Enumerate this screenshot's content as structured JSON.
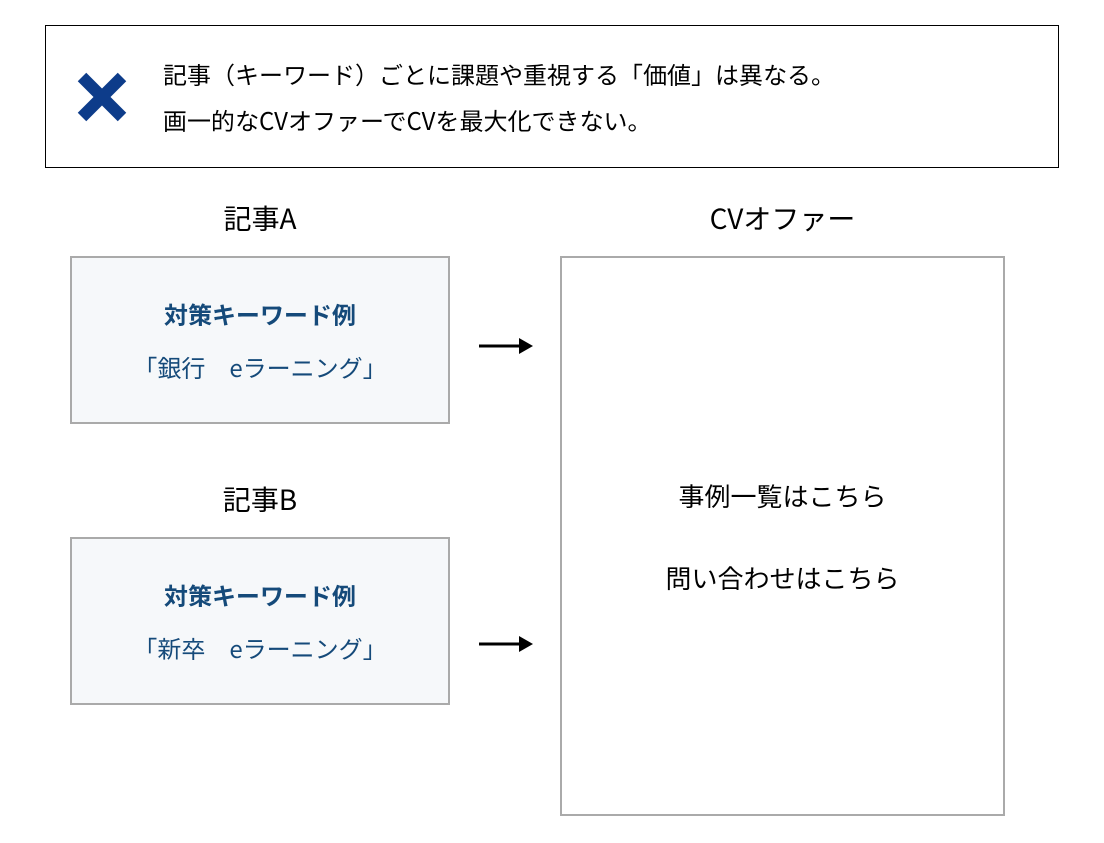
{
  "callout": {
    "line1": "記事（キーワード）ごとに課題や重視する「価値」は異なる。",
    "line2": "画一的なCVオファーでCVを最大化できない。"
  },
  "articles": [
    {
      "title": "記事A",
      "keyword_label": "対策キーワード例",
      "keyword_value": "「銀行　eラーニング」"
    },
    {
      "title": "記事B",
      "keyword_label": "対策キーワード例",
      "keyword_value": "「新卒　eラーニング」"
    }
  ],
  "cv_offer": {
    "title": "CVオファー",
    "lines": [
      "事例一覧はこちら",
      "問い合わせはこちら"
    ]
  }
}
